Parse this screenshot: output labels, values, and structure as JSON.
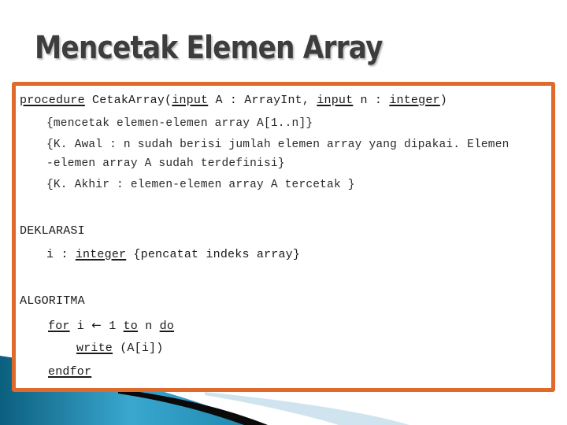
{
  "slide": {
    "title": "Mencetak Elemen Array",
    "accent_color": "#e06a2c"
  },
  "code": {
    "header": {
      "kw_procedure": "procedure",
      "name": " CetakArray(",
      "kw_input1": "input",
      "param1": " A : ArrayInt, ",
      "kw_input2": "input",
      "param2": " n : ",
      "kw_integer": "integer",
      "close": ")"
    },
    "comments": {
      "purpose": "{mencetak elemen-elemen array A[1..n]}",
      "pre_line1": "{K. Awal : n sudah berisi jumlah elemen array yang dipakai. Elemen",
      "pre_line2": "-elemen array A sudah terdefinisi}",
      "post": "{K. Akhir : elemen-elemen array A tercetak }"
    },
    "declaration": {
      "heading": "DEKLARASI",
      "var": "i : ",
      "kw_integer": "integer",
      "comment": " {pencatat indeks array}"
    },
    "algorithm": {
      "heading": "ALGORITMA",
      "kw_for": "for",
      "loop_var": " i ",
      "arrow": "←",
      "start": " 1 ",
      "kw_to": "to",
      "end": " n ",
      "kw_do": "do",
      "kw_write": "write",
      "write_arg": " (A[i])",
      "kw_endfor": "endfor"
    }
  }
}
